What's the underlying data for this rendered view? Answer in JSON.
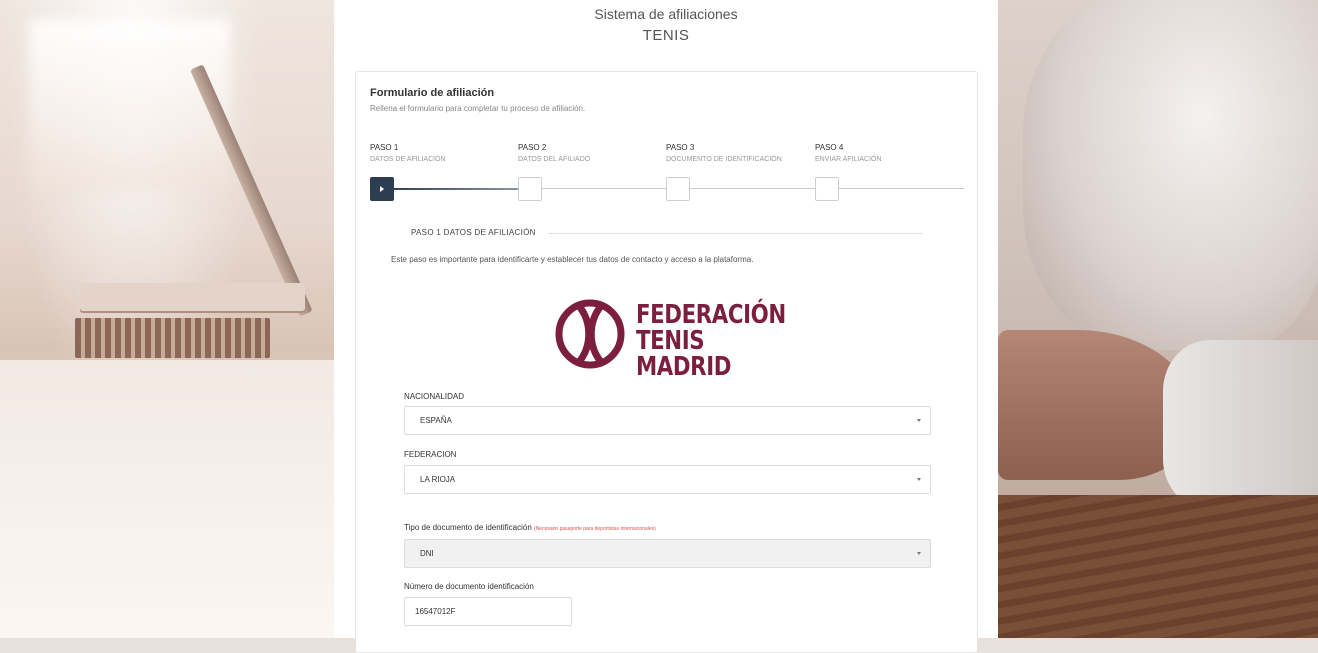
{
  "header": {
    "system_title": "Sistema de afiliaciones",
    "sport": "TENIS"
  },
  "form": {
    "title": "Formulario de afiliación",
    "subtitle": "Rellena el formulario para completar tu proceso de afiliación."
  },
  "steps": [
    {
      "number": "PASO 1",
      "label": "DATOS DE AFILIACIÓN",
      "active": true
    },
    {
      "number": "PASO 2",
      "label": "DATOS DEL AFILIADO",
      "active": false
    },
    {
      "number": "PASO 3",
      "label": "DOCUMENTO DE IDENTIFICACIÓN",
      "active": false
    },
    {
      "number": "PASO 4",
      "label": "ENVIAR AFILIACIÓN",
      "active": false
    }
  ],
  "section": {
    "heading": "PASO 1 DATOS DE AFILIACIÓN",
    "description": "Este paso es importante para identificarte y establecer tus datos de contacto y acceso a la plataforma."
  },
  "logo": {
    "line1": "FEDERACIÓN",
    "line2": "TENIS MADRID",
    "color": "#7c1f3f"
  },
  "fields": {
    "nationality": {
      "label": "NACIONALIDAD",
      "value": "ESPAÑA"
    },
    "federation": {
      "label": "FEDERACION",
      "value": "LA RIOJA"
    },
    "doc_type": {
      "label": "Tipo de documento de identificación",
      "note": "(Necesario pasaporte para deportistas internacionales)",
      "value": "DNI"
    },
    "doc_number": {
      "label": "Número de documento identificación",
      "value": "16547012F"
    }
  },
  "colors": {
    "accent_dark": "#2e3e52",
    "warning": "#d9534f"
  }
}
